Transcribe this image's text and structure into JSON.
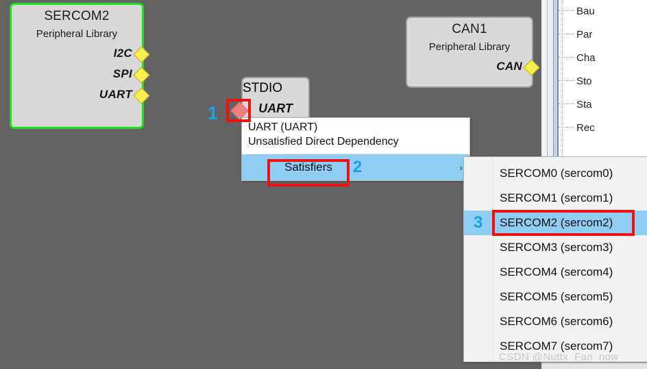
{
  "canvas": {
    "background_color": "#636363"
  },
  "blocks": [
    {
      "id": "sercom2",
      "title": "SERCOM2",
      "subtitle": "Peripheral Library",
      "selected": true,
      "border_color": "#19e219",
      "ports": [
        "I2C",
        "SPI",
        "UART"
      ]
    },
    {
      "id": "can1",
      "title": "CAN1",
      "subtitle": "Peripheral Library",
      "selected": false,
      "border_color": "#9a9a9a",
      "ports": [
        "CAN"
      ]
    }
  ],
  "stdio_block": {
    "title": "STDIO",
    "port_label": "UART",
    "unsatisfied_marker_color": "#f08080"
  },
  "context_menu": {
    "header_line1": "UART (UART)",
    "header_line2": "Unsatisfied Direct Dependency",
    "item_label": "Satisfiers",
    "item_step": "2",
    "submenu_arrow": "›",
    "highlight_color": "#90cdf4"
  },
  "submenu": {
    "items": [
      {
        "label": "SERCOM0 (sercom0)",
        "active": false,
        "step": ""
      },
      {
        "label": "SERCOM1 (sercom1)",
        "active": false,
        "step": ""
      },
      {
        "label": "SERCOM2 (sercom2)",
        "active": true,
        "step": "3"
      },
      {
        "label": "SERCOM3 (sercom3)",
        "active": false,
        "step": ""
      },
      {
        "label": "SERCOM4 (sercom4)",
        "active": false,
        "step": ""
      },
      {
        "label": "SERCOM5 (sercom5)",
        "active": false,
        "step": ""
      },
      {
        "label": "SERCOM6 (sercom6)",
        "active": false,
        "step": ""
      },
      {
        "label": "SERCOM7 (sercom7)",
        "active": false,
        "step": ""
      }
    ]
  },
  "annotations": {
    "step1": "1",
    "step2": "2",
    "step3": "3",
    "box_color": "#ee1111"
  },
  "tree_panel": {
    "items": [
      {
        "label": "Bau"
      },
      {
        "label": "Par"
      },
      {
        "label": "Cha"
      },
      {
        "label": "Sto"
      },
      {
        "label": "Sta"
      },
      {
        "label": "Rec"
      }
    ]
  },
  "watermark": {
    "text": "CSDN @Nuttx_Fan_now"
  }
}
